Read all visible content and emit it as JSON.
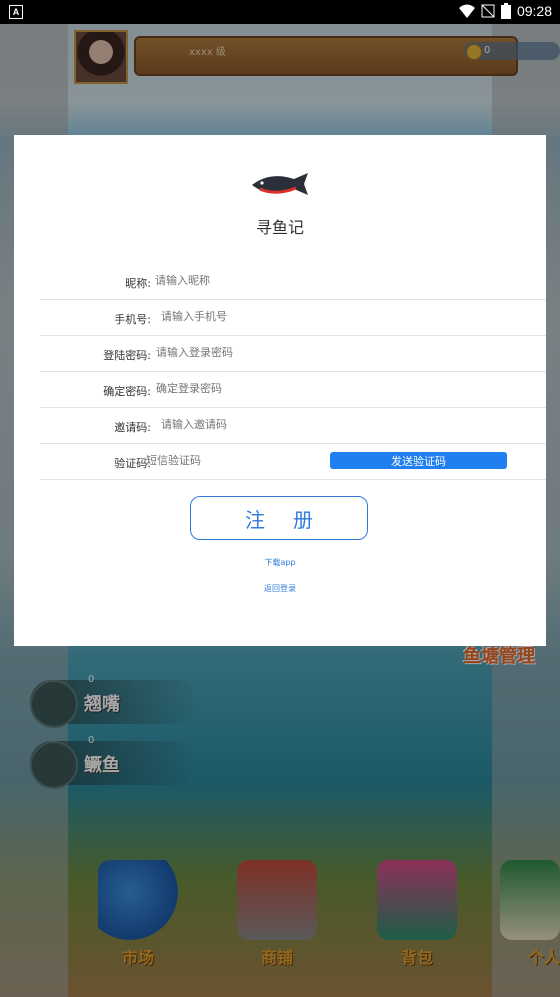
{
  "status_bar": {
    "time": "09:28",
    "left_badge": "A",
    "battery_level": "9"
  },
  "game": {
    "player_name": "xxxx",
    "player_level_suffix": "级",
    "coins": "0",
    "fish_list": [
      {
        "count": "0",
        "name": "翘嘴"
      },
      {
        "count": "0",
        "name": "鳜鱼"
      }
    ],
    "pond_manage_label": "鱼塘管理",
    "nav": [
      {
        "label": "市场",
        "icon": "market-icon"
      },
      {
        "label": "商铺",
        "icon": "shop-cart-icon"
      },
      {
        "label": "背包",
        "icon": "backpack-icon"
      },
      {
        "label": "个人",
        "icon": "home-icon"
      }
    ]
  },
  "modal": {
    "brand": "寻鱼记",
    "fields": [
      {
        "label": "昵称:",
        "placeholder": "请输入昵称"
      },
      {
        "label": "手机号:",
        "placeholder": "请输入手机号"
      },
      {
        "label": "登陆密码:",
        "placeholder": "请输入登录密码"
      },
      {
        "label": "确定密码:",
        "placeholder": "确定登录密码"
      },
      {
        "label": "邀请码:",
        "placeholder": "请输入邀请码"
      },
      {
        "label": "验证码:",
        "placeholder": "短信验证码"
      }
    ],
    "send_code_label": "发送验证码",
    "register_label": "注册",
    "download_link": "下载app",
    "back_login_link": "返回登录"
  },
  "colors": {
    "accent": "#1f7ff0",
    "register_border": "#2f7bd7"
  }
}
